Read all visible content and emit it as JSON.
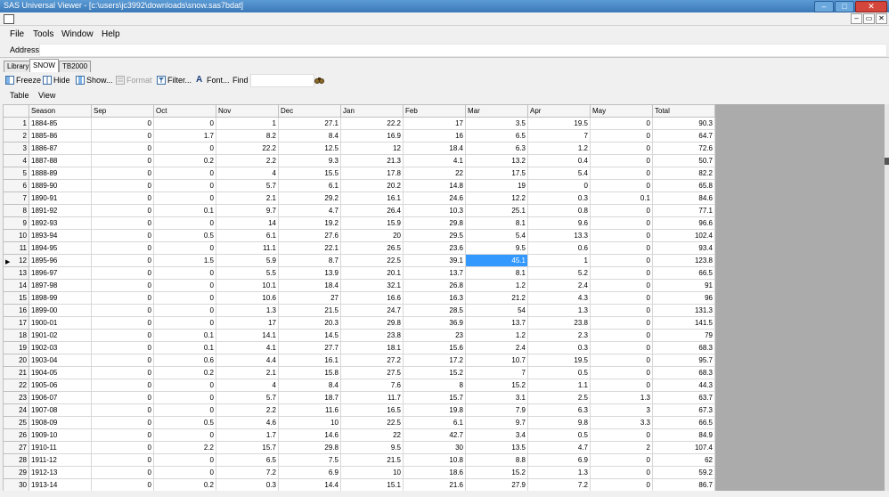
{
  "window": {
    "title": "SAS Universal Viewer - [c:\\users\\jc3992\\downloads\\snow.sas7bdat]",
    "buttons": [
      "–",
      "□",
      "✕"
    ]
  },
  "mdi": {
    "buttons": [
      "–",
      "▭",
      "✕"
    ]
  },
  "menu": {
    "file": "File",
    "tools": "Tools",
    "window": "Window",
    "help": "Help"
  },
  "address": {
    "label": "Address",
    "value": ""
  },
  "tabs": {
    "library": "Library",
    "snow": "SNOW",
    "tb2000": "TB2000"
  },
  "toolbar": {
    "freeze": "Freeze",
    "hide": "Hide",
    "show": "Show...",
    "format": "Format",
    "filter": "Filter...",
    "font": "Font...",
    "find": "Find"
  },
  "submenu": {
    "table": "Table",
    "view": "View"
  },
  "colors": {
    "selection": "#3399ff",
    "empty_area": "#ababab"
  },
  "table": {
    "columns": [
      "Season",
      "Sep",
      "Oct",
      "Nov",
      "Dec",
      "Jan",
      "Feb",
      "Mar",
      "Apr",
      "May",
      "Total"
    ],
    "selected": {
      "row": 12,
      "col": "Mar"
    },
    "rows": [
      [
        "1",
        "1884-85",
        "0",
        "0",
        "1",
        "27.1",
        "22.2",
        "17",
        "3.5",
        "19.5",
        "0",
        "90.3"
      ],
      [
        "2",
        "1885-86",
        "0",
        "1.7",
        "8.2",
        "8.4",
        "16.9",
        "16",
        "6.5",
        "7",
        "0",
        "64.7"
      ],
      [
        "3",
        "1886-87",
        "0",
        "0",
        "22.2",
        "12.5",
        "12",
        "18.4",
        "6.3",
        "1.2",
        "0",
        "72.6"
      ],
      [
        "4",
        "1887-88",
        "0",
        "0.2",
        "2.2",
        "9.3",
        "21.3",
        "4.1",
        "13.2",
        "0.4",
        "0",
        "50.7"
      ],
      [
        "5",
        "1888-89",
        "0",
        "0",
        "4",
        "15.5",
        "17.8",
        "22",
        "17.5",
        "5.4",
        "0",
        "82.2"
      ],
      [
        "6",
        "1889-90",
        "0",
        "0",
        "5.7",
        "6.1",
        "20.2",
        "14.8",
        "19",
        "0",
        "0",
        "65.8"
      ],
      [
        "7",
        "1890-91",
        "0",
        "0",
        "2.1",
        "29.2",
        "16.1",
        "24.6",
        "12.2",
        "0.3",
        "0.1",
        "84.6"
      ],
      [
        "8",
        "1891-92",
        "0",
        "0.1",
        "9.7",
        "4.7",
        "26.4",
        "10.3",
        "25.1",
        "0.8",
        "0",
        "77.1"
      ],
      [
        "9",
        "1892-93",
        "0",
        "0",
        "14",
        "19.2",
        "15.9",
        "29.8",
        "8.1",
        "9.6",
        "0",
        "96.6"
      ],
      [
        "10",
        "1893-94",
        "0",
        "0.5",
        "6.1",
        "27.6",
        "20",
        "29.5",
        "5.4",
        "13.3",
        "0",
        "102.4"
      ],
      [
        "11",
        "1894-95",
        "0",
        "0",
        "11.1",
        "22.1",
        "26.5",
        "23.6",
        "9.5",
        "0.6",
        "0",
        "93.4"
      ],
      [
        "12",
        "1895-96",
        "0",
        "1.5",
        "5.9",
        "8.7",
        "22.5",
        "39.1",
        "45.1",
        "1",
        "0",
        "123.8"
      ],
      [
        "13",
        "1896-97",
        "0",
        "0",
        "5.5",
        "13.9",
        "20.1",
        "13.7",
        "8.1",
        "5.2",
        "0",
        "66.5"
      ],
      [
        "14",
        "1897-98",
        "0",
        "0",
        "10.1",
        "18.4",
        "32.1",
        "26.8",
        "1.2",
        "2.4",
        "0",
        "91"
      ],
      [
        "15",
        "1898-99",
        "0",
        "0",
        "10.6",
        "27",
        "16.6",
        "16.3",
        "21.2",
        "4.3",
        "0",
        "96"
      ],
      [
        "16",
        "1899-00",
        "0",
        "0",
        "1.3",
        "21.5",
        "24.7",
        "28.5",
        "54",
        "1.3",
        "0",
        "131.3"
      ],
      [
        "17",
        "1900-01",
        "0",
        "0",
        "17",
        "20.3",
        "29.8",
        "36.9",
        "13.7",
        "23.8",
        "0",
        "141.5"
      ],
      [
        "18",
        "1901-02",
        "0",
        "0.1",
        "14.1",
        "14.5",
        "23.8",
        "23",
        "1.2",
        "2.3",
        "0",
        "79"
      ],
      [
        "19",
        "1902-03",
        "0",
        "0.1",
        "4.1",
        "27.7",
        "18.1",
        "15.6",
        "2.4",
        "0.3",
        "0",
        "68.3"
      ],
      [
        "20",
        "1903-04",
        "0",
        "0.6",
        "4.4",
        "16.1",
        "27.2",
        "17.2",
        "10.7",
        "19.5",
        "0",
        "95.7"
      ],
      [
        "21",
        "1904-05",
        "0",
        "0.2",
        "2.1",
        "15.8",
        "27.5",
        "15.2",
        "7",
        "0.5",
        "0",
        "68.3"
      ],
      [
        "22",
        "1905-06",
        "0",
        "0",
        "4",
        "8.4",
        "7.6",
        "8",
        "15.2",
        "1.1",
        "0",
        "44.3"
      ],
      [
        "23",
        "1906-07",
        "0",
        "0",
        "5.7",
        "18.7",
        "11.7",
        "15.7",
        "3.1",
        "2.5",
        "1.3",
        "63.7"
      ],
      [
        "24",
        "1907-08",
        "0",
        "0",
        "2.2",
        "11.6",
        "16.5",
        "19.8",
        "7.9",
        "6.3",
        "3",
        "67.3"
      ],
      [
        "25",
        "1908-09",
        "0",
        "0.5",
        "4.6",
        "10",
        "22.5",
        "6.1",
        "9.7",
        "9.8",
        "3.3",
        "66.5"
      ],
      [
        "26",
        "1909-10",
        "0",
        "0",
        "1.7",
        "14.6",
        "22",
        "42.7",
        "3.4",
        "0.5",
        "0",
        "84.9"
      ],
      [
        "27",
        "1910-11",
        "0",
        "2.2",
        "15.7",
        "29.8",
        "9.5",
        "30",
        "13.5",
        "4.7",
        "2",
        "107.4"
      ],
      [
        "28",
        "1911-12",
        "0",
        "0",
        "6.5",
        "7.5",
        "21.5",
        "10.8",
        "8.8",
        "6.9",
        "0",
        "62"
      ],
      [
        "29",
        "1912-13",
        "0",
        "0",
        "7.2",
        "6.9",
        "10",
        "18.6",
        "15.2",
        "1.3",
        "0",
        "59.2"
      ],
      [
        "30",
        "1913-14",
        "0",
        "0.2",
        "0.3",
        "14.4",
        "15.1",
        "21.6",
        "27.9",
        "7.2",
        "0",
        "86.7"
      ]
    ]
  }
}
